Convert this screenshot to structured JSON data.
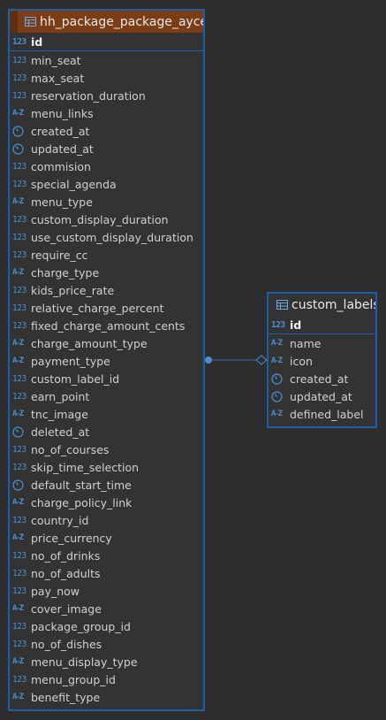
{
  "diagram": {
    "tables": [
      {
        "name": "hh_package_package_ayces",
        "columns": [
          {
            "name": "id",
            "type": "number",
            "pk": true
          },
          {
            "name": "min_seat",
            "type": "number"
          },
          {
            "name": "max_seat",
            "type": "number"
          },
          {
            "name": "reservation_duration",
            "type": "number"
          },
          {
            "name": "menu_links",
            "type": "text"
          },
          {
            "name": "created_at",
            "type": "time"
          },
          {
            "name": "updated_at",
            "type": "time"
          },
          {
            "name": "commision",
            "type": "number"
          },
          {
            "name": "special_agenda",
            "type": "number"
          },
          {
            "name": "menu_type",
            "type": "text"
          },
          {
            "name": "custom_display_duration",
            "type": "number"
          },
          {
            "name": "use_custom_display_duration",
            "type": "number"
          },
          {
            "name": "require_cc",
            "type": "number"
          },
          {
            "name": "charge_type",
            "type": "text"
          },
          {
            "name": "kids_price_rate",
            "type": "number"
          },
          {
            "name": "relative_charge_percent",
            "type": "number"
          },
          {
            "name": "fixed_charge_amount_cents",
            "type": "number"
          },
          {
            "name": "charge_amount_type",
            "type": "text"
          },
          {
            "name": "payment_type",
            "type": "text"
          },
          {
            "name": "custom_label_id",
            "type": "number"
          },
          {
            "name": "earn_point",
            "type": "number"
          },
          {
            "name": "tnc_image",
            "type": "text"
          },
          {
            "name": "deleted_at",
            "type": "time"
          },
          {
            "name": "no_of_courses",
            "type": "number"
          },
          {
            "name": "skip_time_selection",
            "type": "number"
          },
          {
            "name": "default_start_time",
            "type": "time"
          },
          {
            "name": "charge_policy_link",
            "type": "text"
          },
          {
            "name": "country_id",
            "type": "number"
          },
          {
            "name": "price_currency",
            "type": "text"
          },
          {
            "name": "no_of_drinks",
            "type": "number"
          },
          {
            "name": "no_of_adults",
            "type": "number"
          },
          {
            "name": "pay_now",
            "type": "number"
          },
          {
            "name": "cover_image",
            "type": "text"
          },
          {
            "name": "package_group_id",
            "type": "number"
          },
          {
            "name": "no_of_dishes",
            "type": "number"
          },
          {
            "name": "menu_display_type",
            "type": "text"
          },
          {
            "name": "menu_group_id",
            "type": "number"
          },
          {
            "name": "benefit_type",
            "type": "text"
          }
        ]
      },
      {
        "name": "custom_labels",
        "columns": [
          {
            "name": "id",
            "type": "number",
            "pk": true
          },
          {
            "name": "name",
            "type": "text"
          },
          {
            "name": "icon",
            "type": "text"
          },
          {
            "name": "created_at",
            "type": "time"
          },
          {
            "name": "updated_at",
            "type": "time"
          },
          {
            "name": "defined_label",
            "type": "text"
          }
        ]
      }
    ],
    "type_icons": {
      "number": "123",
      "text": "A-Z",
      "time": "clock-icon"
    },
    "colors": {
      "background": "#2d2d2d",
      "entity_border": "#1a5fa8",
      "main_header": "#7a3d16",
      "type_icon": "#4b8fd1"
    }
  }
}
